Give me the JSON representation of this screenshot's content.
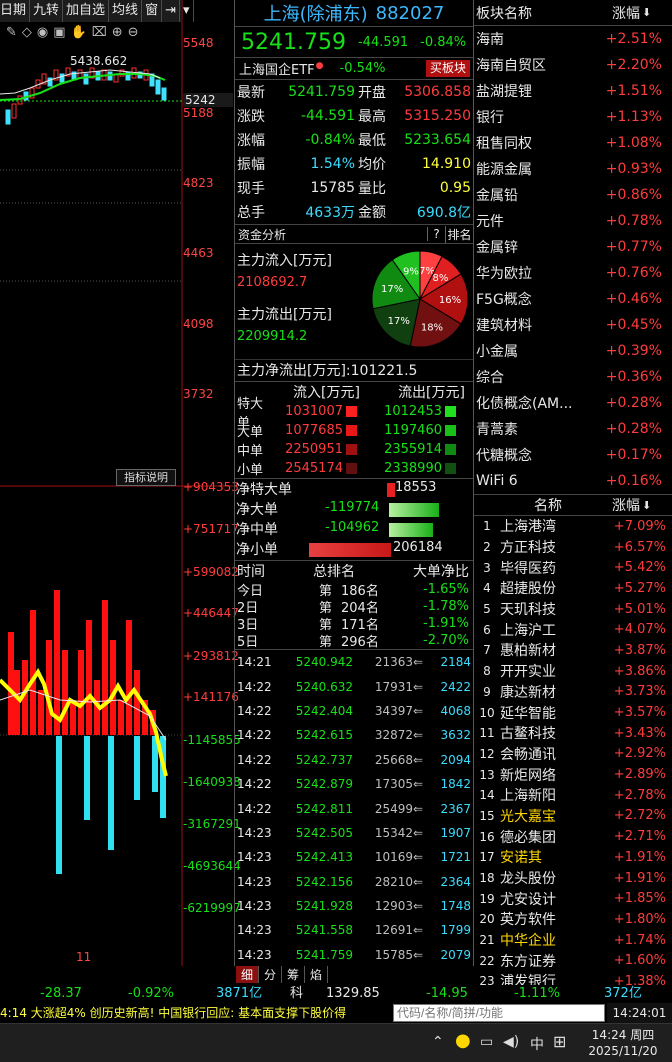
{
  "tabs": [
    "日期",
    "九转",
    "加自选",
    "均线",
    "窗"
  ],
  "left_axis": {
    "price": [
      "5548",
      "5188",
      "4823",
      "4463",
      "4098",
      "3732"
    ],
    "current": "5242",
    "peak": "5438.662",
    "flow": [
      "+904353",
      "+751717",
      "+599082",
      "+446447",
      "+293812",
      "+141176",
      "-1145855",
      "-1640938",
      "-3167291",
      "-4693644",
      "-6219997"
    ],
    "xtick": "11",
    "indicator_btn": "指标说明"
  },
  "quote": {
    "title": "上海(除浦东)",
    "code": "882027",
    "price": "5241.759",
    "change": "-44.591",
    "pct": "-0.84%",
    "etf_name": "上海国企ETF",
    "etf_pct": "-0.54%",
    "etf_btn": "买板块",
    "rows": [
      [
        "最新",
        "5241.759",
        "开盘",
        "5306.858"
      ],
      [
        "涨跌",
        "-44.591",
        "最高",
        "5315.250"
      ],
      [
        "涨幅",
        "-0.84%",
        "最低",
        "5233.654"
      ],
      [
        "振幅",
        "1.54%",
        "均价",
        "14.910"
      ],
      [
        "现手",
        "15785",
        "量比",
        "0.95"
      ],
      [
        "总手",
        "4633万",
        "金额",
        "690.8亿"
      ]
    ]
  },
  "fund": {
    "header": "资金分析",
    "btn_q": "?",
    "btn_rank": "排名",
    "in_label": "主力流入[万元]",
    "in_val": "2108692.7",
    "out_label": "主力流出[万元]",
    "out_val": "2209914.2",
    "net": "主力净流出[万元]:101221.5",
    "pie": [
      "7%",
      "8%",
      "16%",
      "18%",
      "17%",
      "17%",
      "9%"
    ],
    "head": [
      "流入[万元]",
      "流出[万元]"
    ],
    "orders": [
      [
        "特大单",
        "1031007",
        "1012453"
      ],
      [
        "大单",
        "1077685",
        "1197460"
      ],
      [
        "中单",
        "2250951",
        "2355914"
      ],
      [
        "小单",
        "2545174",
        "2338990"
      ]
    ],
    "net_rows": [
      [
        "净特大单",
        "18553"
      ],
      [
        "净大单",
        "-119774"
      ],
      [
        "净中单",
        "-104962"
      ],
      [
        "净小单",
        "206184"
      ]
    ],
    "rank_head": [
      "时间",
      "总排名",
      "大单净比"
    ],
    "rank": [
      [
        "今日",
        "第",
        "186名",
        "-1.65%"
      ],
      [
        "2日",
        "第",
        "204名",
        "-1.78%"
      ],
      [
        "3日",
        "第",
        "171名",
        "-1.91%"
      ],
      [
        "5日",
        "第",
        "296名",
        "-2.70%"
      ]
    ]
  },
  "ticks": [
    [
      "14:21",
      "5240.942",
      "21363",
      "2184"
    ],
    [
      "14:22",
      "5240.632",
      "17931",
      "2422"
    ],
    [
      "14:22",
      "5242.404",
      "34397",
      "4068"
    ],
    [
      "14:22",
      "5242.615",
      "32872",
      "3632"
    ],
    [
      "14:22",
      "5242.737",
      "25668",
      "2094"
    ],
    [
      "14:22",
      "5242.879",
      "17305",
      "1842"
    ],
    [
      "14:22",
      "5242.811",
      "25499",
      "2367"
    ],
    [
      "14:23",
      "5242.505",
      "15342",
      "1907"
    ],
    [
      "14:23",
      "5242.413",
      "10169",
      "1721"
    ],
    [
      "14:23",
      "5242.156",
      "28210",
      "2364"
    ],
    [
      "14:23",
      "5241.928",
      "12903",
      "1748"
    ],
    [
      "14:23",
      "5241.558",
      "12691",
      "1799"
    ],
    [
      "14:23",
      "5241.759",
      "15785",
      "2079"
    ]
  ],
  "bottom_tabs": [
    "细",
    "分",
    "筹",
    "焰"
  ],
  "sectors": {
    "head_name": "板块名称",
    "head_pct": "涨幅",
    "items": [
      [
        "海南",
        "+2.51%"
      ],
      [
        "海南自贸区",
        "+2.20%"
      ],
      [
        "盐湖提锂",
        "+1.51%"
      ],
      [
        "银行",
        "+1.13%"
      ],
      [
        "租售同权",
        "+1.08%"
      ],
      [
        "能源金属",
        "+0.93%"
      ],
      [
        "金属铅",
        "+0.86%"
      ],
      [
        "元件",
        "+0.78%"
      ],
      [
        "金属锌",
        "+0.77%"
      ],
      [
        "华为欧拉",
        "+0.76%"
      ],
      [
        "F5G概念",
        "+0.46%"
      ],
      [
        "建筑材料",
        "+0.45%"
      ],
      [
        "小金属",
        "+0.39%"
      ],
      [
        "综合",
        "+0.36%"
      ],
      [
        "化债概念(AM...",
        "+0.28%"
      ],
      [
        "青蒿素",
        "+0.28%"
      ],
      [
        "代糖概念",
        "+0.17%"
      ],
      [
        "WiFi 6",
        "+0.16%"
      ]
    ]
  },
  "stocks": {
    "head_name": "名称",
    "head_pct": "涨幅",
    "items": [
      [
        "1",
        "上海港湾",
        "+7.09%"
      ],
      [
        "2",
        "方正科技",
        "+6.57%"
      ],
      [
        "3",
        "毕得医药",
        "+5.42%"
      ],
      [
        "4",
        "超捷股份",
        "+5.27%"
      ],
      [
        "5",
        "天玑科技",
        "+5.01%"
      ],
      [
        "6",
        "上海沪工",
        "+4.07%"
      ],
      [
        "7",
        "惠柏新材",
        "+3.87%"
      ],
      [
        "8",
        "开开实业",
        "+3.86%"
      ],
      [
        "9",
        "康达新材",
        "+3.73%"
      ],
      [
        "10",
        "延华智能",
        "+3.57%"
      ],
      [
        "11",
        "古鳌科技",
        "+3.43%"
      ],
      [
        "12",
        "会畅通讯",
        "+2.92%"
      ],
      [
        "13",
        "新炬网络",
        "+2.89%"
      ],
      [
        "14",
        "上海新阳",
        "+2.78%"
      ],
      [
        "15",
        "光大嘉宝",
        "+2.72%"
      ],
      [
        "16",
        "德必集团",
        "+2.71%"
      ],
      [
        "17",
        "安诺其",
        "+1.91%"
      ],
      [
        "18",
        "龙头股份",
        "+1.91%"
      ],
      [
        "19",
        "尤安设计",
        "+1.85%"
      ],
      [
        "20",
        "英方软件",
        "+1.80%"
      ],
      [
        "21",
        "中华企业",
        "+1.74%"
      ],
      [
        "22",
        "东方证券",
        "+1.60%"
      ],
      [
        "23",
        "浦发银行",
        "+1.38%"
      ]
    ]
  },
  "index_bar": {
    "a": "-28.37",
    "b": "-0.92%",
    "c": "3871亿",
    "d": "科",
    "e": "1329.85",
    "f": "-14.95",
    "g": "-1.11%",
    "h": "372亿"
  },
  "scroll_text": "4:14 大涨超4% 创历史新高! 中国银行回应: 基本面支撑下股价得",
  "search_placeholder": "代码/名称/简拼/功能",
  "clock": "14:24:01",
  "taskbar": {
    "ime": "中",
    "time": "14:24 周四",
    "date": "2025/11/20"
  }
}
